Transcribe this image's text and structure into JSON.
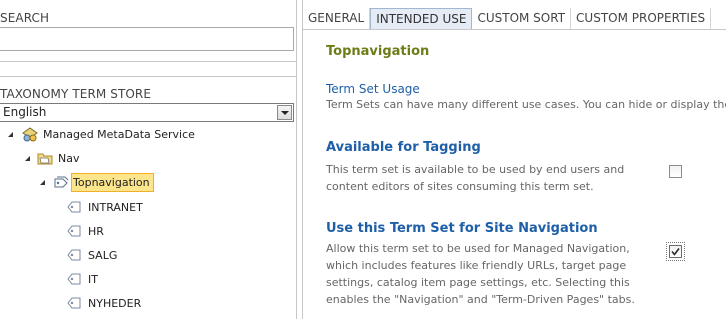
{
  "left": {
    "search_label": "SEARCH",
    "search_value": "",
    "taxonomy_label": "TAXONOMY TERM STORE",
    "language_selected": "English",
    "tree": {
      "store": "Managed MetaData Service",
      "group": "Nav",
      "term_set": "Topnavigation",
      "terms": [
        "INTRANET",
        "HR",
        "SALG",
        "IT",
        "NYHEDER"
      ]
    }
  },
  "right": {
    "tabs": [
      "GENERAL",
      "INTENDED USE",
      "CUSTOM SORT",
      "CUSTOM PROPERTIES"
    ],
    "active_tab": "INTENDED USE",
    "title": "Topnavigation",
    "usage_heading": "Term Set Usage",
    "usage_desc": "Term Sets can have many different use cases. You can hide or display the tal",
    "tagging_heading": "Available for Tagging",
    "tagging_desc": [
      "This term set is available to be used by end users and",
      "content editors of sites consuming this term set."
    ],
    "tagging_checked": false,
    "nav_heading": "Use this Term Set for Site Navigation",
    "nav_desc": [
      "Allow this term set to be used for Managed Navigation,",
      "which includes features like friendly URLs, target page",
      "settings, catalog item page settings, etc. Selecting this",
      "enables the \"Navigation\" and \"Term-Driven Pages\" tabs."
    ],
    "nav_checked": true
  },
  "icons": {
    "store": "term-store-icon",
    "group": "folder-group-icon",
    "term_set": "term-set-icon",
    "term": "tag-icon"
  }
}
